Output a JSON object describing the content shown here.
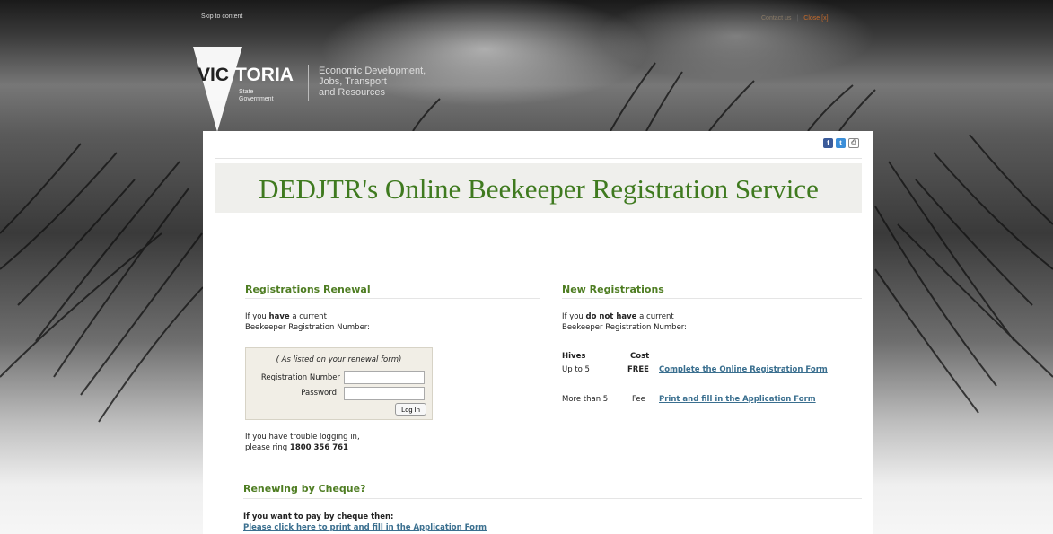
{
  "header": {
    "skip_link": "Skip to content",
    "top_links": [
      "Contact us",
      "Close [x]"
    ],
    "logo": {
      "wordmark": "VICTORIA",
      "sub1": "State",
      "sub2": "Government",
      "dept_line1": "Economic Development,",
      "dept_line2": "Jobs, Transport",
      "dept_line3": "and Resources"
    },
    "social": {
      "facebook": "f",
      "twitter": "t",
      "print": "⎙"
    }
  },
  "banner": {
    "title": "DEDJTR's Online Beekeeper Registration Service"
  },
  "renewal": {
    "title": "Registrations Renewal",
    "intro_pre": "If you ",
    "intro_bold": "have",
    "intro_post": " a current",
    "intro_line2": "Beekeeper Registration Number:",
    "hint": "( As listed on your renewal form)",
    "reg_label": "Registration Number",
    "reg_value": "",
    "password_label": "Password",
    "password_value": "",
    "login_button": "Log In",
    "trouble_line1": "If you have trouble logging in,",
    "trouble_pre": "please ring ",
    "trouble_phone": "1800 356 761"
  },
  "new_reg": {
    "title": "New Registrations",
    "intro_pre": "If you ",
    "intro_bold": "do not have",
    "intro_post": " a current",
    "intro_line2": "Beekeeper Registration Number:",
    "col_hives": "Hives",
    "col_cost": "Cost",
    "rows": [
      {
        "hives": "Up to 5",
        "cost": "FREE",
        "link": "Complete the Online Registration Form"
      },
      {
        "hives": "More than 5",
        "cost": "Fee",
        "link": "Print and fill in the Application Form"
      }
    ]
  },
  "cheque": {
    "title": "Renewing by Cheque?",
    "line1": "If you want to pay by cheque then:",
    "link": "Please click here to print and fill in the Application Form"
  },
  "colors": {
    "green": "#4e7d22",
    "link": "#3a6f8f",
    "banner_title": "#3f7a1f"
  }
}
